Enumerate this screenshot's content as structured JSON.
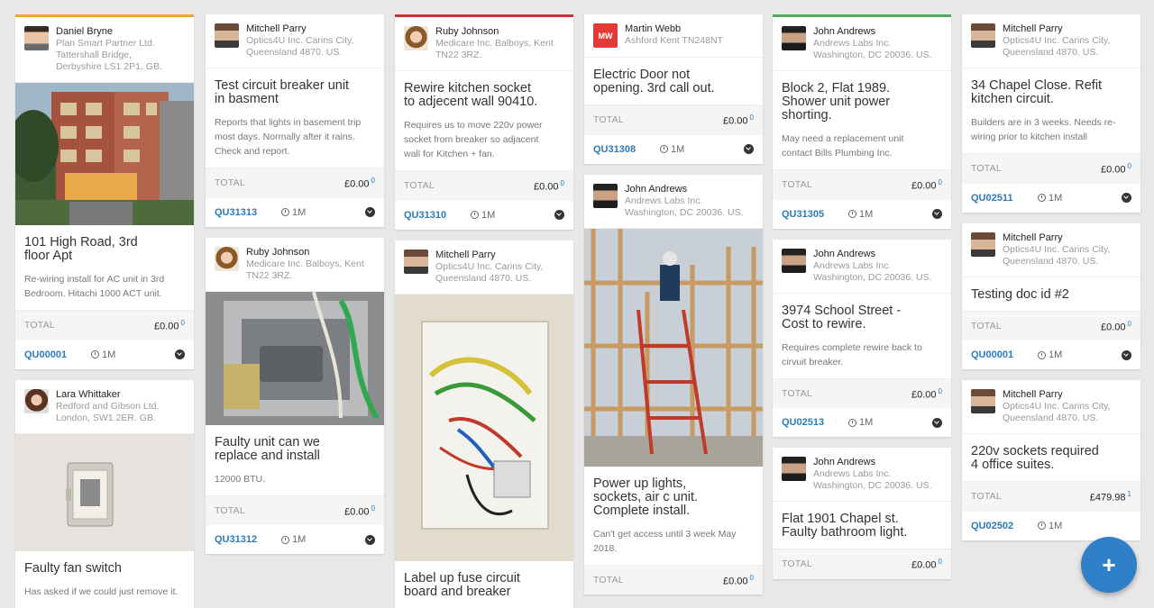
{
  "columns": [
    [
      {
        "name": "Daniel Bryne",
        "addr": [
          "Plan Smart Partner Ltd.",
          "Tattershall Bridge,",
          "Derbyshire LS1 2P1. GB."
        ],
        "title": [
          "101 High Road, 3rd",
          "floor Apt"
        ],
        "desc": [
          "Re-wiring install for AC unit in 3rd",
          "Bedroom. Hitachi 1000 ACT unit."
        ],
        "total_label": "TOTAL",
        "amount": "£0.00",
        "count": "0",
        "ref": "QU00001",
        "age": "1M"
      },
      {
        "name": "Lara Whittaker",
        "addr": [
          "Redford and Gibson Ltd.",
          "London, SW1 2ER. GB."
        ],
        "title": [
          "Faulty fan switch"
        ],
        "desc": [
          "Has asked if we could just remove it."
        ]
      }
    ],
    [
      {
        "name": "Mitchell Parry",
        "addr": [
          "Optics4U Inc. Carins City,",
          "Queensland 4870. US."
        ],
        "title": [
          "Test circuit breaker unit",
          "in basment"
        ],
        "desc": [
          "Reports that lights in basement trip",
          "most days. Normally after it rains.",
          "Check and report."
        ],
        "total_label": "TOTAL",
        "amount": "£0.00",
        "count": "0",
        "ref": "QU31313",
        "age": "1M"
      },
      {
        "name": "Ruby Johnson",
        "addr": [
          "Medicare Inc. Balboys, Kent",
          "TN22 3RZ."
        ],
        "title": [
          "Faulty unit can we",
          "replace and install"
        ],
        "desc": [
          "12000 BTU."
        ],
        "total_label": "TOTAL",
        "amount": "£0.00",
        "count": "0",
        "ref": "QU31312",
        "age": "1M"
      }
    ],
    [
      {
        "name": "Ruby Johnson",
        "addr": [
          "Medicare Inc. Balboys, Kent",
          "TN22 3RZ."
        ],
        "title": [
          "Rewire kitchen socket",
          "to adjecent wall 90410."
        ],
        "desc": [
          "Requires us to move 220v power",
          "socket from breaker so adjacent",
          "wall for Kitchen + fan."
        ],
        "total_label": "TOTAL",
        "amount": "£0.00",
        "count": "0",
        "ref": "QU31310",
        "age": "1M"
      },
      {
        "name": "Mitchell Parry",
        "addr": [
          "Optics4U Inc. Carins City,",
          "Queensland 4870. US."
        ],
        "title": [
          "Label up fuse circuit",
          "board and breaker"
        ]
      }
    ],
    [
      {
        "name": "Martin Webb",
        "avatar_text": "MW",
        "addr": [
          "Ashford Kent TN248NT"
        ],
        "title": [
          "Electric Door not",
          "opening. 3rd call out."
        ],
        "total_label": "TOTAL",
        "amount": "£0.00",
        "count": "0",
        "ref": "QU31308",
        "age": "1M"
      },
      {
        "name": "John Andrews",
        "addr": [
          "Andrews Labs Inc.",
          "Washington, DC 20036. US."
        ],
        "title": [
          "Power up lights,",
          "sockets, air c unit.",
          "Complete install."
        ],
        "desc": [
          "Can't get access until 3 week May",
          "2018."
        ],
        "total_label": "TOTAL",
        "amount": "£0.00",
        "count": "0"
      }
    ],
    [
      {
        "name": "John Andrews",
        "addr": [
          "Andrews Labs Inc.",
          "Washington, DC 20036. US."
        ],
        "title": [
          "Block 2, Flat 1989.",
          "Shower unit power",
          "shorting."
        ],
        "desc": [
          "May need a replacement unit",
          "contact Bills Plumbing Inc."
        ],
        "total_label": "TOTAL",
        "amount": "£0.00",
        "count": "0",
        "ref": "QU31305",
        "age": "1M"
      },
      {
        "name": "John Andrews",
        "addr": [
          "Andrews Labs Inc.",
          "Washington, DC 20036. US."
        ],
        "title": [
          "3974 School Street -",
          "Cost to rewire."
        ],
        "desc": [
          "Requires complete rewire back to",
          "cirvuit breaker."
        ],
        "total_label": "TOTAL",
        "amount": "£0.00",
        "count": "0",
        "ref": "QU02513",
        "age": "1M"
      },
      {
        "name": "John Andrews",
        "addr": [
          "Andrews Labs Inc.",
          "Washington, DC 20036. US."
        ],
        "title": [
          "Flat 1901 Chapel st.",
          "Faulty bathroom light."
        ],
        "total_label": "TOTAL",
        "amount": "£0.00",
        "count": "0"
      }
    ],
    [
      {
        "name": "Mitchell Parry",
        "addr": [
          "Optics4U Inc. Carins City,",
          "Queensland 4870. US."
        ],
        "title": [
          "34 Chapel Close. Refit",
          "kitchen circuit."
        ],
        "desc": [
          "Builders are in 3 weeks. Needs re-",
          "wiring prior to kitchen install"
        ],
        "total_label": "TOTAL",
        "amount": "£0.00",
        "count": "0",
        "ref": "QU02511",
        "age": "1M"
      },
      {
        "name": "Mitchell Parry",
        "addr": [
          "Optics4U Inc. Carins City,",
          "Queensland 4870. US."
        ],
        "title": [
          "Testing doc id #2"
        ],
        "total_label": "TOTAL",
        "amount": "£0.00",
        "count": "0",
        "ref": "QU00001",
        "age": "1M"
      },
      {
        "name": "Mitchell Parry",
        "addr": [
          "Optics4U Inc. Carins City,",
          "Queensland 4870. US."
        ],
        "title": [
          "220v sockets required",
          "4 office suites."
        ],
        "total_label": "TOTAL",
        "amount": "£479.98",
        "count": "1",
        "ref": "QU02502",
        "age": "1M"
      }
    ]
  ],
  "fab": {
    "label": "+",
    "icon": "plus-icon"
  },
  "colors": {
    "accent": "#2f80c8",
    "link": "#2b7bb9",
    "bar_orange": "#f5a623",
    "bar_red": "#d32f2f",
    "bar_green": "#4caf50"
  }
}
